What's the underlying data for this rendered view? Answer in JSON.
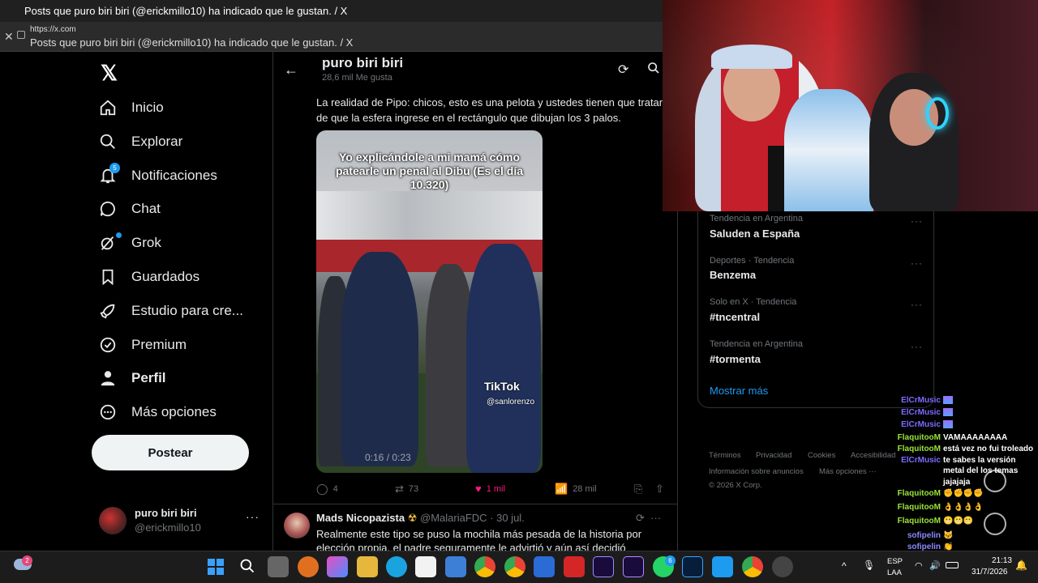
{
  "window": {
    "title": "Posts que puro biri biri (@erickmillo10) ha indicado que le gustan. / X",
    "url": "https://x.com",
    "tab_title": "Posts que puro biri biri (@erickmillo10) ha indicado que le gustan. / X"
  },
  "nav": {
    "items": [
      {
        "label": "Inicio",
        "icon": "home-icon"
      },
      {
        "label": "Explorar",
        "icon": "search-icon"
      },
      {
        "label": "Notificaciones",
        "icon": "bell-icon",
        "badge": "5"
      },
      {
        "label": "Chat",
        "icon": "chat-icon"
      },
      {
        "label": "Grok",
        "icon": "grok-icon"
      },
      {
        "label": "Guardados",
        "icon": "bookmark-icon"
      },
      {
        "label": "Estudio para cre...",
        "icon": "rocket-icon"
      },
      {
        "label": "Premium",
        "icon": "verified-icon"
      },
      {
        "label": "Perfil",
        "icon": "person-icon"
      },
      {
        "label": "Más opciones",
        "icon": "more-icon"
      }
    ],
    "post_button": "Postear",
    "account": {
      "name": "puro biri biri",
      "handle": "@erickmillo10",
      "more": "···"
    }
  },
  "header": {
    "title": "puro biri biri",
    "subtitle": "28,6 mil Me gusta"
  },
  "tweet": {
    "text": "La realidad de Pipo: chicos, esto es una pelota y ustedes tienen que tratar de que la esfera ingrese en el rectángulo que dibujan los 3 palos.",
    "video_caption": "Yo explicándole a mi mamá cómo patearle un penal al Dibu (Es el día 10.320)",
    "watermark": "TikTok",
    "watermark_user": "@sanlorenzo",
    "time": "0:16 / 0:23",
    "replies": "4",
    "reposts": "73",
    "likes": "1 mil",
    "views": "28 mil"
  },
  "tweet2": {
    "author": "Mads Nicopazista",
    "emoji": "☢",
    "handle": "@MalariaFDC",
    "date": "· 30 jul.",
    "text": "Realmente este tipo se puso la mochila más pesada de la historia por elección propia. el padre seguramente le advirtió y aún así decidió hacerlo."
  },
  "trends": [
    {
      "category": "Tendencia en Argentina",
      "name": "Saluden a España"
    },
    {
      "category": "Deportes · Tendencia",
      "name": "Benzema"
    },
    {
      "category": "Solo en X · Tendencia",
      "name": "#tncentral"
    },
    {
      "category": "Tendencia en Argentina",
      "name": "#tormenta"
    }
  ],
  "show_more": "Mostrar más",
  "footer": {
    "links": [
      "Términos",
      "Privacidad",
      "Cookies",
      "Accesibilidad"
    ],
    "links2": [
      "Información sobre anuncios",
      "Más opciones ···"
    ],
    "copyright": "© 2026 X Corp."
  },
  "chat": [
    {
      "user": "ElCrMusic",
      "msg": "",
      "color": "#7b6cff"
    },
    {
      "user": "ElCrMusic",
      "msg": "",
      "color": "#7b6cff"
    },
    {
      "user": "ElCrMusic",
      "msg": "",
      "color": "#7b6cff"
    },
    {
      "user": "FlaquitooM",
      "msg": "VAMAAAAAAAA",
      "color": "#9be23a"
    },
    {
      "user": "FlaquitooM",
      "msg": "está vez no fui troleado",
      "color": "#9be23a"
    },
    {
      "user": "ElCrMusic",
      "msg": "te sabes la versión",
      "color": "#7b6cff"
    },
    {
      "user": "",
      "msg": "metal del los temas",
      "color": "#7b6cff"
    },
    {
      "user": "",
      "msg": "jajajaja",
      "color": "#7b6cff"
    },
    {
      "user": "FlaquitooM",
      "msg": "",
      "color": "#9be23a"
    },
    {
      "user": "FlaquitooM",
      "msg": "",
      "color": "#9be23a"
    },
    {
      "user": "FlaquitooM",
      "msg": "",
      "color": "#9be23a"
    },
    {
      "user": "sofipelin",
      "msg": "",
      "color": "#8a8aff"
    },
    {
      "user": "sofipelin",
      "msg": "",
      "color": "#8a8aff"
    }
  ],
  "taskbar": {
    "weather_badge": "2",
    "whatsapp_badge": "6",
    "lang": "ESP",
    "lang2": "LAA",
    "time": "21:13",
    "date": "31/7/2026"
  }
}
